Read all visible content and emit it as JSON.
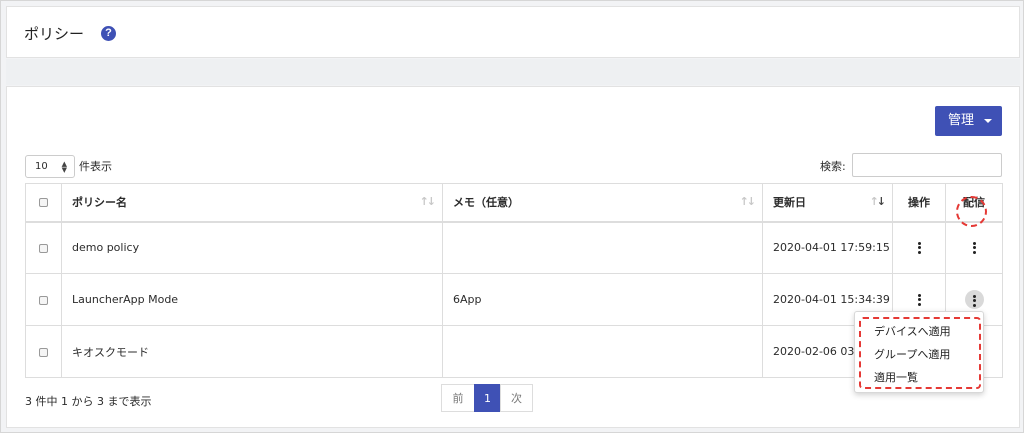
{
  "header": {
    "title": "ポリシー",
    "help_icon_glyph": "?"
  },
  "toolbar": {
    "manage_label": "管理"
  },
  "length": {
    "value": "10",
    "label": "件表示"
  },
  "search": {
    "label": "検索:",
    "value": ""
  },
  "table": {
    "columns": [
      "",
      "ポリシー名",
      "メモ（任意）",
      "更新日",
      "操作",
      "配信"
    ],
    "rows": [
      {
        "name": "demo policy",
        "memo": "",
        "updated": "2020-04-01 17:59:15"
      },
      {
        "name": "LauncherApp Mode",
        "memo": "6App",
        "updated": "2020-04-01 15:34:39"
      },
      {
        "name": "キオスクモード",
        "memo": "",
        "updated": "2020-02-06 03:3"
      }
    ]
  },
  "dropdown": {
    "items": [
      "デバイスへ適用",
      "グループへ適用",
      "適用一覧"
    ]
  },
  "footer": {
    "info": "3 件中 1 から 3 まで表示"
  },
  "pagination": {
    "prev": "前",
    "current": "1",
    "next": "次"
  },
  "colors": {
    "accent": "#3f51b5",
    "highlight": "#e53935"
  }
}
